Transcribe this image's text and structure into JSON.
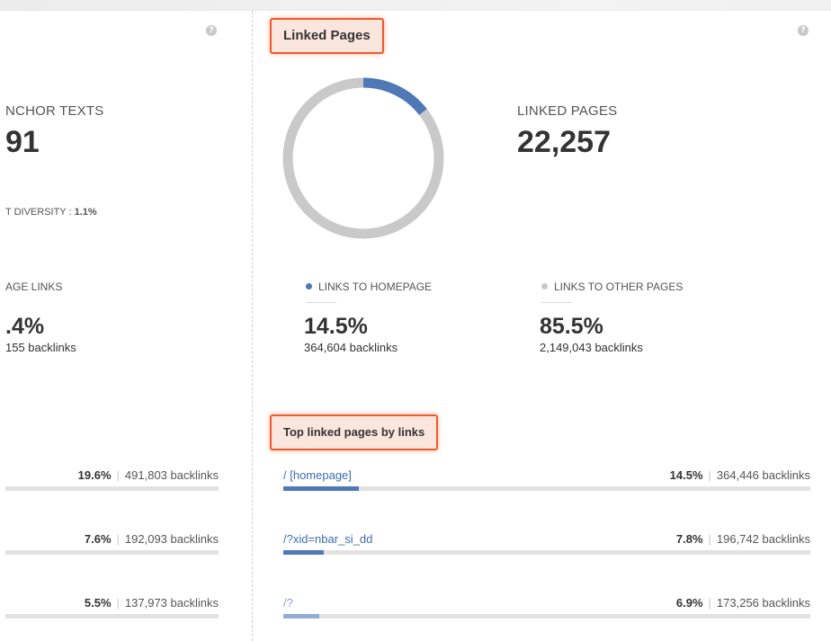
{
  "left_panel": {
    "help_icon": "question-circle-icon",
    "title": "NCHOR TEXTS",
    "count": "91",
    "diversity_label": "T DIVERSITY :",
    "diversity_value": "1.1%",
    "homepage_links_label": "AGE LINKS",
    "homepage_pct": ".4%",
    "homepage_backlinks": "155 backlinks",
    "rows": [
      {
        "pct": "19.6%",
        "backlinks": "491,803 backlinks",
        "fill": 0.196
      },
      {
        "pct": "7.6%",
        "backlinks": "192,093 backlinks",
        "fill": 0.076
      },
      {
        "pct": "5.5%",
        "backlinks": "137,973 backlinks",
        "fill": 0.055
      }
    ]
  },
  "right_panel": {
    "help_icon": "question-circle-icon",
    "callout_title": "Linked Pages",
    "title": "LINKED PAGES",
    "count": "22,257",
    "donut": {
      "homepage_fraction": 0.145,
      "other_fraction": 0.855,
      "homepage_color": "#4f78b6",
      "other_color": "#c9c9c9"
    },
    "legend": [
      {
        "label": "LINKS TO HOMEPAGE",
        "color": "#4f78b6",
        "pct": "14.5%",
        "backlinks": "364,604 backlinks"
      },
      {
        "label": "LINKS TO OTHER PAGES",
        "color": "#c9c9c9",
        "pct": "85.5%",
        "backlinks": "2,149,043 backlinks"
      }
    ],
    "top_callout": "Top linked pages by links",
    "rows": [
      {
        "path": "/ [homepage]",
        "pct": "14.5%",
        "backlinks": "364,446 backlinks",
        "fill": 0.145
      },
      {
        "path": "/?xid=nbar_si_dd",
        "pct": "7.8%",
        "backlinks": "196,742 backlinks",
        "fill": 0.078
      },
      {
        "path": "/?",
        "pct": "6.9%",
        "backlinks": "173,256 backlinks",
        "fill": 0.069
      }
    ]
  },
  "colors": {
    "accent_blue": "#4f78b6",
    "callout_border": "#f0592a",
    "callout_bg": "#fbe6dd"
  }
}
